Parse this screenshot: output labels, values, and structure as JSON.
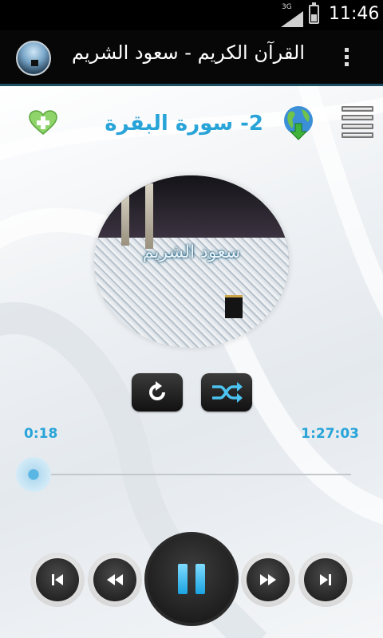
{
  "status_bar": {
    "network": "3G",
    "time": "11:46"
  },
  "action_bar": {
    "title": "القرآن الكريم - سعود الشريم",
    "overflow_icon": "overflow-menu-icon"
  },
  "toolbar": {
    "favorite_icon": "heart-plus-icon",
    "sura_title": "2- سورة البقرة",
    "download_icon": "globe-download-icon",
    "menu_icon": "list-menu-icon"
  },
  "cover": {
    "caption": "سعود الشريم"
  },
  "controls": {
    "repeat_icon": "repeat-icon",
    "shuffle_icon": "shuffle-icon"
  },
  "progress": {
    "current_time": "0:18",
    "total_time": "1:27:03",
    "fraction": 0.003
  },
  "transport": {
    "prev_icon": "skip-previous-icon",
    "rewind_icon": "rewind-icon",
    "pause_icon": "pause-icon",
    "forward_icon": "fast-forward-icon",
    "next_icon": "skip-next-icon"
  },
  "colors": {
    "accent": "#29a4d8",
    "action_bar_bg": "#070707",
    "status_bar_bg": "#000000"
  }
}
